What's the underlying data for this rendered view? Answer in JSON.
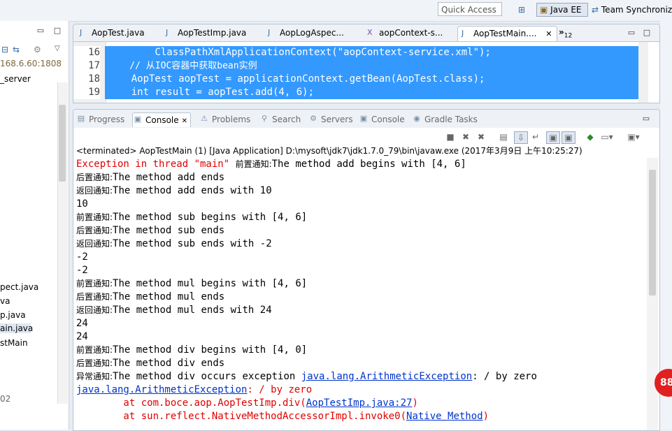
{
  "toolbar": {
    "quick_access_placeholder": "Quick Access",
    "perspective_javaee": "Java EE",
    "perspective_team": "Team Synchroniz"
  },
  "left_panel": {
    "items": [
      {
        "label": "168.6.60:1808"
      },
      {
        "label": "_server"
      },
      {
        "label": "pect.java"
      },
      {
        "label": "va"
      },
      {
        "label": "p.java"
      },
      {
        "label": "ain.java"
      },
      {
        "label": "stMain"
      },
      {
        "label": "02"
      }
    ]
  },
  "editor": {
    "tabs": [
      {
        "label": "AopTest.java",
        "icon": "java-interface-icon"
      },
      {
        "label": "AopTestImp.java",
        "icon": "java-class-icon"
      },
      {
        "label": "AopLogAspec...",
        "icon": "java-class-icon"
      },
      {
        "label": "aopContext-s...",
        "icon": "xml-file-icon"
      },
      {
        "label": "AopTestMain....",
        "icon": "java-class-icon",
        "active": true
      }
    ],
    "overflow_count": "12",
    "lines": [
      {
        "num": "16",
        "code": "        ClassPathXmlApplicationContext(\"aopContext-service.xml\");"
      },
      {
        "num": "17",
        "code": "    // 从IOC容器中获取bean实例"
      },
      {
        "num": "18",
        "code": "    AopTest aopTest = applicationContext.getBean(AopTest.class);"
      },
      {
        "num": "19",
        "code": "    int result = aopTest.add(4, 6);"
      }
    ]
  },
  "console_tabs": [
    {
      "label": "Progress",
      "icon": "progress-icon"
    },
    {
      "label": "Console",
      "icon": "console-icon",
      "active": true
    },
    {
      "label": "Problems",
      "icon": "problems-icon"
    },
    {
      "label": "Search",
      "icon": "search-icon"
    },
    {
      "label": "Servers",
      "icon": "servers-icon"
    },
    {
      "label": "Console",
      "icon": "console-icon"
    },
    {
      "label": "Gradle Tasks",
      "icon": "gradle-icon"
    }
  ],
  "console": {
    "status": "<terminated> AopTestMain (1) [Java Application] D:\\mysoft\\jdk7\\jdk1.7.0_79\\bin\\javaw.exe (2017年3月9日 上午10:25:27)",
    "lines": [
      {
        "parts": [
          {
            "t": "Exception in thread \"main\" ",
            "c": "err"
          },
          {
            "t": "前置通知:",
            "c": "cjk"
          },
          {
            "t": "The method add begins with [4, 6]"
          }
        ]
      },
      {
        "parts": [
          {
            "t": "后置通知:",
            "c": "cjk"
          },
          {
            "t": "The method add ends"
          }
        ]
      },
      {
        "parts": [
          {
            "t": "返回通知:",
            "c": "cjk"
          },
          {
            "t": "The method add ends with 10"
          }
        ]
      },
      {
        "parts": [
          {
            "t": "10"
          }
        ]
      },
      {
        "parts": [
          {
            "t": "前置通知:",
            "c": "cjk"
          },
          {
            "t": "The method sub begins with [4, 6]"
          }
        ]
      },
      {
        "parts": [
          {
            "t": "后置通知:",
            "c": "cjk"
          },
          {
            "t": "The method sub ends"
          }
        ]
      },
      {
        "parts": [
          {
            "t": "返回通知:",
            "c": "cjk"
          },
          {
            "t": "The method sub ends with -2"
          }
        ]
      },
      {
        "parts": [
          {
            "t": "-2"
          }
        ]
      },
      {
        "parts": [
          {
            "t": "-2"
          }
        ]
      },
      {
        "parts": [
          {
            "t": "前置通知:",
            "c": "cjk"
          },
          {
            "t": "The method mul begins with [4, 6]"
          }
        ]
      },
      {
        "parts": [
          {
            "t": "后置通知:",
            "c": "cjk"
          },
          {
            "t": "The method mul ends"
          }
        ]
      },
      {
        "parts": [
          {
            "t": "返回通知:",
            "c": "cjk"
          },
          {
            "t": "The method mul ends with 24"
          }
        ]
      },
      {
        "parts": [
          {
            "t": "24"
          }
        ]
      },
      {
        "parts": [
          {
            "t": "24"
          }
        ]
      },
      {
        "parts": [
          {
            "t": "前置通知:",
            "c": "cjk"
          },
          {
            "t": "The method div begins with [4, 0]"
          }
        ]
      },
      {
        "parts": [
          {
            "t": "后置通知:",
            "c": "cjk"
          },
          {
            "t": "The method div ends"
          }
        ]
      },
      {
        "parts": [
          {
            "t": "异常通知:",
            "c": "cjk"
          },
          {
            "t": "The method div occurs exception "
          },
          {
            "t": "java.lang.ArithmeticException",
            "c": "link"
          },
          {
            "t": ": / by zero"
          }
        ]
      },
      {
        "parts": [
          {
            "t": "java.lang.ArithmeticException",
            "c": "link"
          },
          {
            "t": ": / by zero",
            "c": "err"
          }
        ]
      },
      {
        "parts": [
          {
            "t": "        at com.boce.aop.AopTestImp.div(",
            "c": "err"
          },
          {
            "t": "AopTestImp.java:27",
            "c": "link"
          },
          {
            "t": ")",
            "c": "err"
          }
        ]
      },
      {
        "parts": [
          {
            "t": "        at sun.reflect.NativeMethodAccessorImpl.invoke0(",
            "c": "err"
          },
          {
            "t": "Native Method",
            "c": "link"
          },
          {
            "t": ")",
            "c": "err"
          }
        ]
      }
    ]
  },
  "badge": {
    "text": "88"
  }
}
